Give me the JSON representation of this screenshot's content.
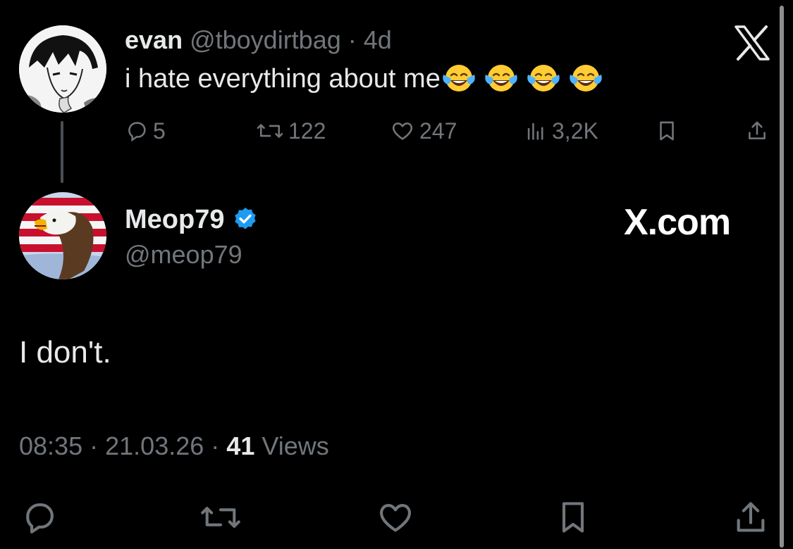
{
  "parent_tweet": {
    "name": "evan",
    "handle": "@tboydirtbag",
    "separator": "·",
    "age": "4d",
    "text": "i hate everything about me",
    "emoji": [
      "face-with-tears-of-joy",
      "face-with-tears-of-joy",
      "face-with-tears-of-joy",
      "face-with-tears-of-joy"
    ],
    "replies": "5",
    "reposts": "122",
    "likes": "247",
    "views": "3,2K"
  },
  "reply_tweet": {
    "name": "Meop79",
    "handle": "@meop79",
    "verified": true,
    "text": "I don't.",
    "time": "08:35",
    "date": "21.03.26",
    "dot": "·",
    "views_count": "41",
    "views_label": "Views"
  },
  "branding": {
    "watermark": "X.com"
  },
  "colors": {
    "background": "#000000",
    "text": "#e7e9ea",
    "secondary": "#71767b",
    "verified_blue": "#1d9bf0"
  }
}
